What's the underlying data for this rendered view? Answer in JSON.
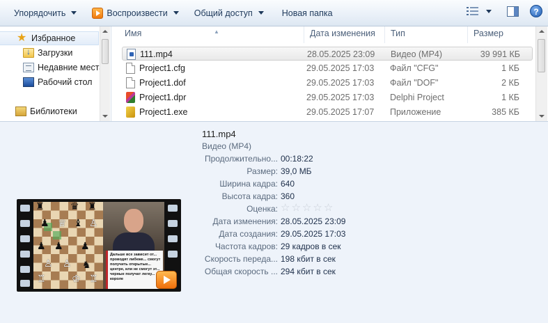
{
  "toolbar": {
    "organize_label": "Упорядочить",
    "play_label": "Воспроизвести",
    "share_label": "Общий доступ",
    "new_folder_label": "Новая папка"
  },
  "nav": {
    "items": [
      {
        "label": "Избранное",
        "icon": "star-icon"
      },
      {
        "label": "Загрузки",
        "icon": "downloads-folder-icon"
      },
      {
        "label": "Недавние места",
        "icon": "recent-places-icon"
      },
      {
        "label": "Рабочий стол",
        "icon": "desktop-icon"
      },
      {
        "label": "Библиотеки",
        "icon": "libraries-icon"
      }
    ]
  },
  "columns": {
    "name": "Имя",
    "modified": "Дата изменения",
    "type": "Тип",
    "size": "Размер"
  },
  "files": [
    {
      "name": "111.mp4",
      "modified": "28.05.2025 23:09",
      "type": "Видео (MP4)",
      "size": "39 991 КБ",
      "icon": "mp4-file-icon"
    },
    {
      "name": "Project1.cfg",
      "modified": "29.05.2025 17:03",
      "type": "Файл \"CFG\"",
      "size": "1 КБ",
      "icon": "document-file-icon"
    },
    {
      "name": "Project1.dof",
      "modified": "29.05.2025 17:03",
      "type": "Файл \"DOF\"",
      "size": "2 КБ",
      "icon": "document-file-icon"
    },
    {
      "name": "Project1.dpr",
      "modified": "29.05.2025 17:03",
      "type": "Delphi Project",
      "size": "1 КБ",
      "icon": "delphi-project-icon"
    },
    {
      "name": "Project1.exe",
      "modified": "29.05.2025 17:07",
      "type": "Приложение",
      "size": "385 КБ",
      "icon": "exe-file-icon"
    }
  ],
  "details": {
    "file_name": "111.mp4",
    "file_type": "Видео (MP4)",
    "rating_stars": 0,
    "rating_max": 5,
    "properties": [
      {
        "label": "Продолжительно...",
        "value": "00:18:22"
      },
      {
        "label": "Размер:",
        "value": "39,0 МБ"
      },
      {
        "label": "Ширина кадра:",
        "value": "640"
      },
      {
        "label": "Высота кадра:",
        "value": "360"
      },
      {
        "label": "Оценка:",
        "value": ""
      },
      {
        "label": "Дата изменения:",
        "value": "28.05.2025 23:09"
      },
      {
        "label": "Дата создания:",
        "value": "29.05.2025 17:03"
      },
      {
        "label": "Частота кадров:",
        "value": "29 кадров в сек"
      },
      {
        "label": "Скорость переда...",
        "value": "198 кбит в сек"
      },
      {
        "label": "Общая скорость ...",
        "value": "294 кбит в сек"
      }
    ],
    "thumbnail_caption": "Дальше все зависит от... проводят либеже... смогут получить открытые... центре, или не смогут эт... черные получат легку... короле"
  },
  "colors": {
    "toolbar_text": "#1e395b",
    "details_bg": "#eef3fa",
    "label_text": "#5a6a7e"
  }
}
